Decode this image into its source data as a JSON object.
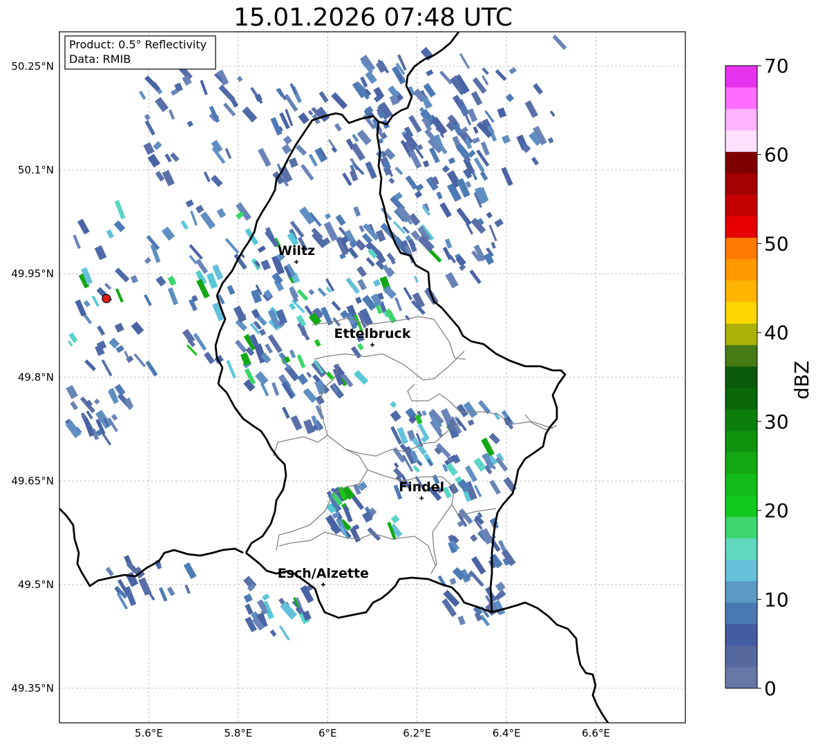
{
  "title": "15.01.2026 07:48 UTC",
  "info_box": {
    "product": "Product: 0.5° Reflectivity",
    "data": "Data: RMIB"
  },
  "lat_ticks": [
    {
      "value": 50.25,
      "label": "50.25°N"
    },
    {
      "value": 50.1,
      "label": "50.1°N"
    },
    {
      "value": 49.95,
      "label": "49.95°N"
    },
    {
      "value": 49.8,
      "label": "49.8°N"
    },
    {
      "value": 49.65,
      "label": "49.65°N"
    },
    {
      "value": 49.5,
      "label": "49.5°N"
    },
    {
      "value": 49.35,
      "label": "49.35°N"
    }
  ],
  "lon_ticks": [
    {
      "value": 5.6,
      "label": "5.6°E"
    },
    {
      "value": 5.8,
      "label": "5.8°E"
    },
    {
      "value": 6.0,
      "label": "6°E"
    },
    {
      "value": 6.2,
      "label": "6.2°E"
    },
    {
      "value": 6.4,
      "label": "6.4°E"
    },
    {
      "value": 6.6,
      "label": "6.6°E"
    }
  ],
  "extent": {
    "lon_min": 5.4,
    "lon_max": 6.8,
    "lat_min": 49.3,
    "lat_max": 50.3
  },
  "cities": [
    {
      "name": "Wiltz",
      "lon": 5.93,
      "lat": 49.967
    },
    {
      "name": "Ettelbruck",
      "lon": 6.1,
      "lat": 49.847
    },
    {
      "name": "Findel",
      "lon": 6.21,
      "lat": 49.625
    },
    {
      "name": "Esch/Alzette",
      "lon": 5.99,
      "lat": 49.5
    }
  ],
  "radar_site": {
    "lon": 5.505,
    "lat": 49.914,
    "color": "#e11a1a"
  },
  "colorbar": {
    "label": "dBZ",
    "min": 0,
    "max": 70,
    "step": 2.5,
    "tick_labels": [
      "0",
      "10",
      "20",
      "30",
      "40",
      "50",
      "60",
      "70"
    ],
    "colors": [
      "#6677a8",
      "#55699e",
      "#445da2",
      "#4a78b0",
      "#5a9ac4",
      "#66c0da",
      "#60d8c0",
      "#3cd66c",
      "#11c81e",
      "#13bb18",
      "#12a814",
      "#109410",
      "#0c7e0c",
      "#096808",
      "#0a5a0a",
      "#457a14",
      "#aab20a",
      "#ffd700",
      "#ffb500",
      "#ff9a00",
      "#ff7b00",
      "#e60000",
      "#c40000",
      "#a30000",
      "#800000",
      "#ffe0ff",
      "#ffb4ff",
      "#ff6cff",
      "#e532ee"
    ]
  },
  "colors": {
    "border_country": "#000000",
    "border_canton": "#808080",
    "grid": "#b0b0b0"
  }
}
